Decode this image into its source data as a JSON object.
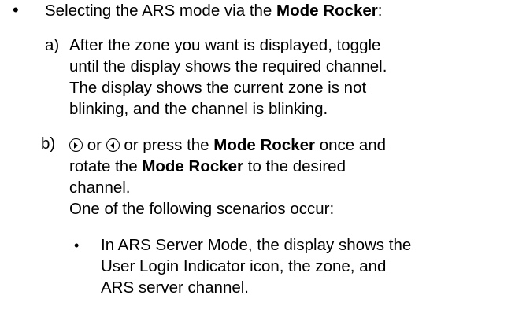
{
  "bullet1": {
    "symbol": "•",
    "text_before": "Selecting the ARS mode via the ",
    "bold": "Mode Rocker",
    "text_after": ":"
  },
  "step_a": {
    "label": "a)",
    "lines": [
      "After the zone you want is displayed, toggle",
      "until the display shows the required channel.",
      "The display shows the current zone is not",
      "blinking, and the channel is blinking."
    ]
  },
  "step_b": {
    "label": "b)",
    "line1": {
      "icon_right": "right-arrow-circle-icon",
      "or1": " or ",
      "icon_left": "left-arrow-circle-icon",
      "text1": " or press the ",
      "bold": "Mode Rocker",
      "text2": " once and"
    },
    "line2": {
      "text1": "rotate the ",
      "bold": "Mode Rocker",
      "text2": " to the desired"
    },
    "line3": "channel.",
    "line4": "One of the following scenarios occur:"
  },
  "sub_bullet": {
    "symbol": "•",
    "lines": [
      "In ARS Server Mode, the display shows the",
      "User Login Indicator icon, the zone, and",
      "ARS server channel."
    ]
  }
}
